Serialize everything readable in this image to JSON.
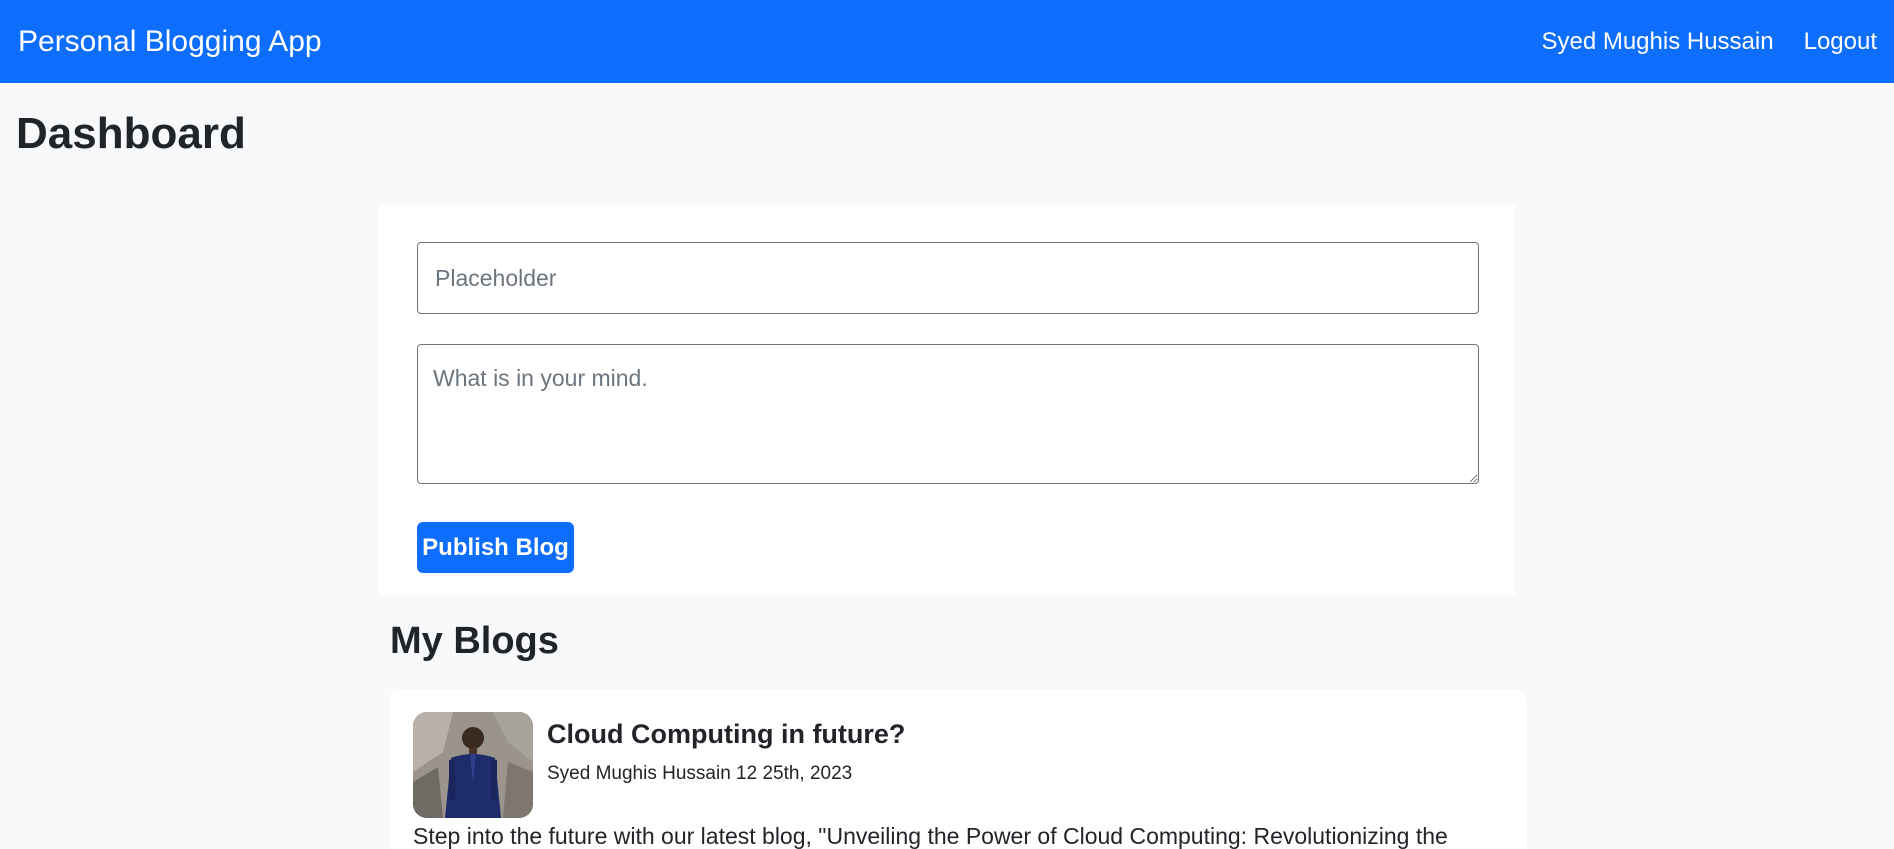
{
  "navbar": {
    "brand": "Personal Blogging App",
    "user_name": "Syed Mughis Hussain",
    "logout_label": "Logout"
  },
  "page": {
    "title": "Dashboard"
  },
  "form": {
    "title_placeholder": "Placeholder",
    "body_placeholder": "What is in your mind.",
    "publish_label": "Publish Blog"
  },
  "my_blogs": {
    "heading": "My Blogs",
    "posts": [
      {
        "title": "Cloud Computing in future?",
        "meta": "Syed Mughis Hussain 12 25th, 2023",
        "excerpt": "Step into the future with our latest blog, \"Unveiling the Power of Cloud Computing: Revolutionizing the"
      }
    ]
  },
  "colors": {
    "primary": "#0d6efd",
    "page_background": "#f8f9fa",
    "card_background": "#ffffff",
    "text": "#212529",
    "placeholder_text": "#6c757d"
  }
}
